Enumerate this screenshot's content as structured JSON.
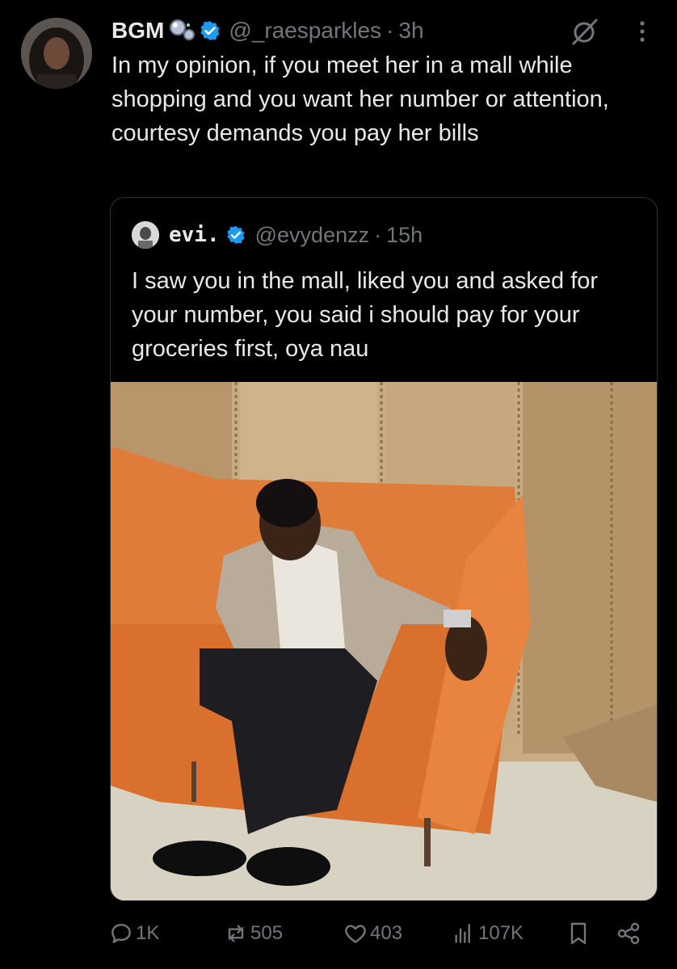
{
  "tweet": {
    "author_name": "BGM",
    "handle": "@_raesparkles",
    "separator": "·",
    "time": "3h",
    "text": "In my opinion, if you meet her in a mall while shopping and you want her number or attention, courtesy demands you pay her bills"
  },
  "quoted_tweet": {
    "author_name": "evi.",
    "handle": "@evydenzz",
    "separator": "·",
    "time": "15h",
    "text": "I saw you in the mall, liked you and asked for your number, you said i should pay for your groceries first, oya nau"
  },
  "actions": {
    "replies": "1K",
    "reposts": "505",
    "likes": "403",
    "views": "107K"
  },
  "icons": [
    "emoji-decoration-icon",
    "verified-badge-icon",
    "grok-icon",
    "more-options-icon",
    "reply-icon",
    "repost-icon",
    "like-icon",
    "views-icon",
    "bookmark-icon",
    "share-icon"
  ],
  "colors": {
    "background": "#000000",
    "text_primary": "#e7e9ea",
    "text_secondary": "#71767b",
    "verified": "#1d9bf0",
    "border": "#2f3336"
  }
}
